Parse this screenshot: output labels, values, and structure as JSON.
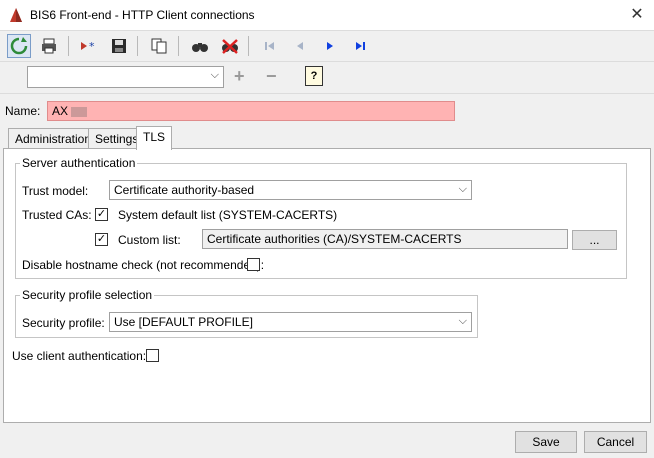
{
  "window": {
    "title": "BIS6 Front-end - HTTP Client connections",
    "close_glyph": "✕"
  },
  "toolbar": {
    "icons": [
      "refresh-icon",
      "print-icon",
      "new-icon",
      "save-icon",
      "copy-icon",
      "find-icon",
      "clear-filter-icon",
      "first-icon",
      "previous-icon",
      "next-icon",
      "last-icon"
    ]
  },
  "row2": {
    "combo_value": "",
    "plus": "+",
    "minus": "−",
    "help": "?"
  },
  "name": {
    "label": "Name:",
    "value": "AX"
  },
  "tabs": [
    "Administration",
    "Settings",
    "TLS"
  ],
  "server_auth": {
    "legend": "Server authentication",
    "trust_model_label": "Trust model:",
    "trust_model_value": "Certificate authority-based",
    "trusted_cas_label": "Trusted CAs:",
    "system_default_label": "System default list (SYSTEM-CACERTS)",
    "system_default_checked": true,
    "custom_list_label": "Custom list:",
    "custom_list_checked": true,
    "custom_list_value": "Certificate authorities (CA)/SYSTEM-CACERTS",
    "browse_label": "...",
    "disable_hostname_label": "Disable hostname check (not recommended):",
    "disable_hostname_checked": false
  },
  "security_profile": {
    "legend": "Security profile selection",
    "label": "Security profile:",
    "value": "Use [DEFAULT PROFILE]"
  },
  "client_auth": {
    "label": "Use client authentication:",
    "checked": false
  },
  "footer": {
    "save": "Save",
    "cancel": "Cancel"
  },
  "glyphs": {
    "check": "✓",
    "dropdown": "⌵"
  }
}
